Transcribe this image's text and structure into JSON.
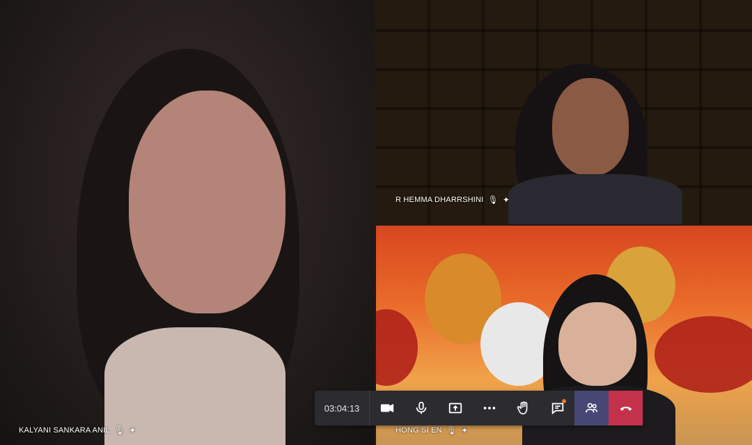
{
  "meeting": {
    "timer": "03:04:13",
    "participants": [
      {
        "name": "KALYANI SANKARA ANIL",
        "muted_icon": "mic-off-icon",
        "pin_icon": "pin-icon"
      },
      {
        "name": "R HEMMA DHARRSHINI",
        "muted_icon": "mic-off-icon",
        "pin_icon": "pin-icon"
      },
      {
        "name": "HONG SI EN",
        "muted_icon": "mic-off-icon",
        "pin_icon": "pin-icon"
      }
    ]
  },
  "controls": {
    "items": [
      "video-camera-icon",
      "microphone-icon",
      "share-screen-icon",
      "more-options-icon",
      "raise-hand-icon",
      "chat-icon",
      "participants-icon",
      "hang-up-icon"
    ],
    "participants_bg": "#464775",
    "hangup_bg": "#c4314b",
    "chat_notification_color": "#e9782c"
  }
}
